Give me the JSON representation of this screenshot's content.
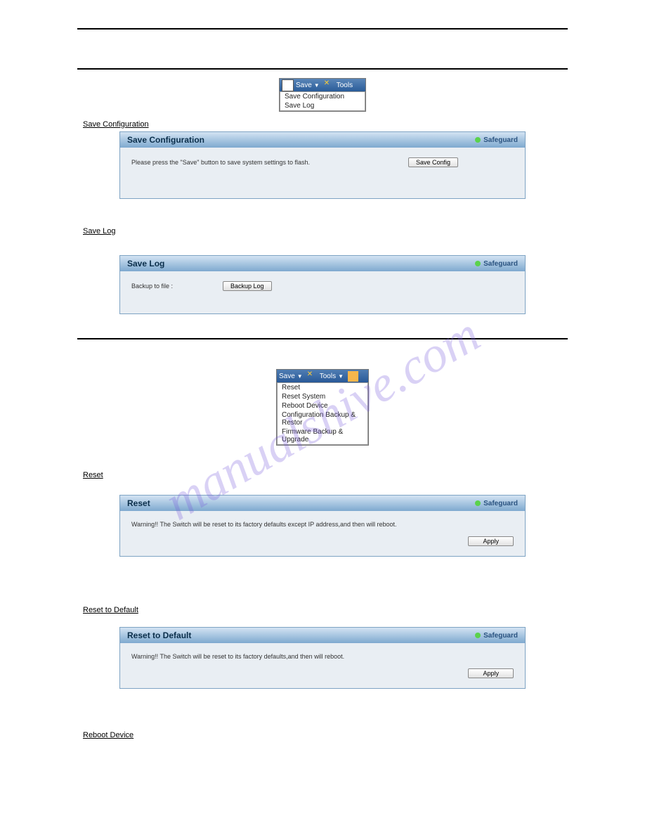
{
  "saveMenu": {
    "toolbar": {
      "saveLabel": "Save",
      "toolsLabel": "Tools"
    },
    "items": [
      "Save Configuration",
      "Save Log"
    ]
  },
  "sections": {
    "saveConfigHeading": "Save Configuration",
    "saveLogHeading": "Save Log",
    "resetHeading": "Reset",
    "resetDefaultHeading": "Reset to Default",
    "rebootHeading": "Reboot Device"
  },
  "panels": {
    "saveConfig": {
      "title": "Save Configuration",
      "safeguard": "Safeguard",
      "msg": "Please press the \"Save\" button to save system settings to flash.",
      "btn": "Save Config"
    },
    "saveLog": {
      "title": "Save Log",
      "safeguard": "Safeguard",
      "label": "Backup to file :",
      "btn": "Backup Log"
    },
    "reset": {
      "title": "Reset",
      "safeguard": "Safeguard",
      "msg": "Warning!! The Switch will be reset to its factory defaults except IP address,and then will reboot.",
      "btn": "Apply"
    },
    "resetDefault": {
      "title": "Reset to Default",
      "safeguard": "Safeguard",
      "msg": "Warning!! The Switch will be reset to its factory defaults,and then will reboot.",
      "btn": "Apply"
    }
  },
  "toolsMenu": {
    "toolbar": {
      "saveLabel": "Save",
      "toolsLabel": "Tools"
    },
    "items": [
      "Reset",
      "Reset System",
      "Reboot Device",
      "Configuration Backup & Restor",
      "Firmware Backup & Upgrade"
    ]
  },
  "watermark": "manualshive.com"
}
